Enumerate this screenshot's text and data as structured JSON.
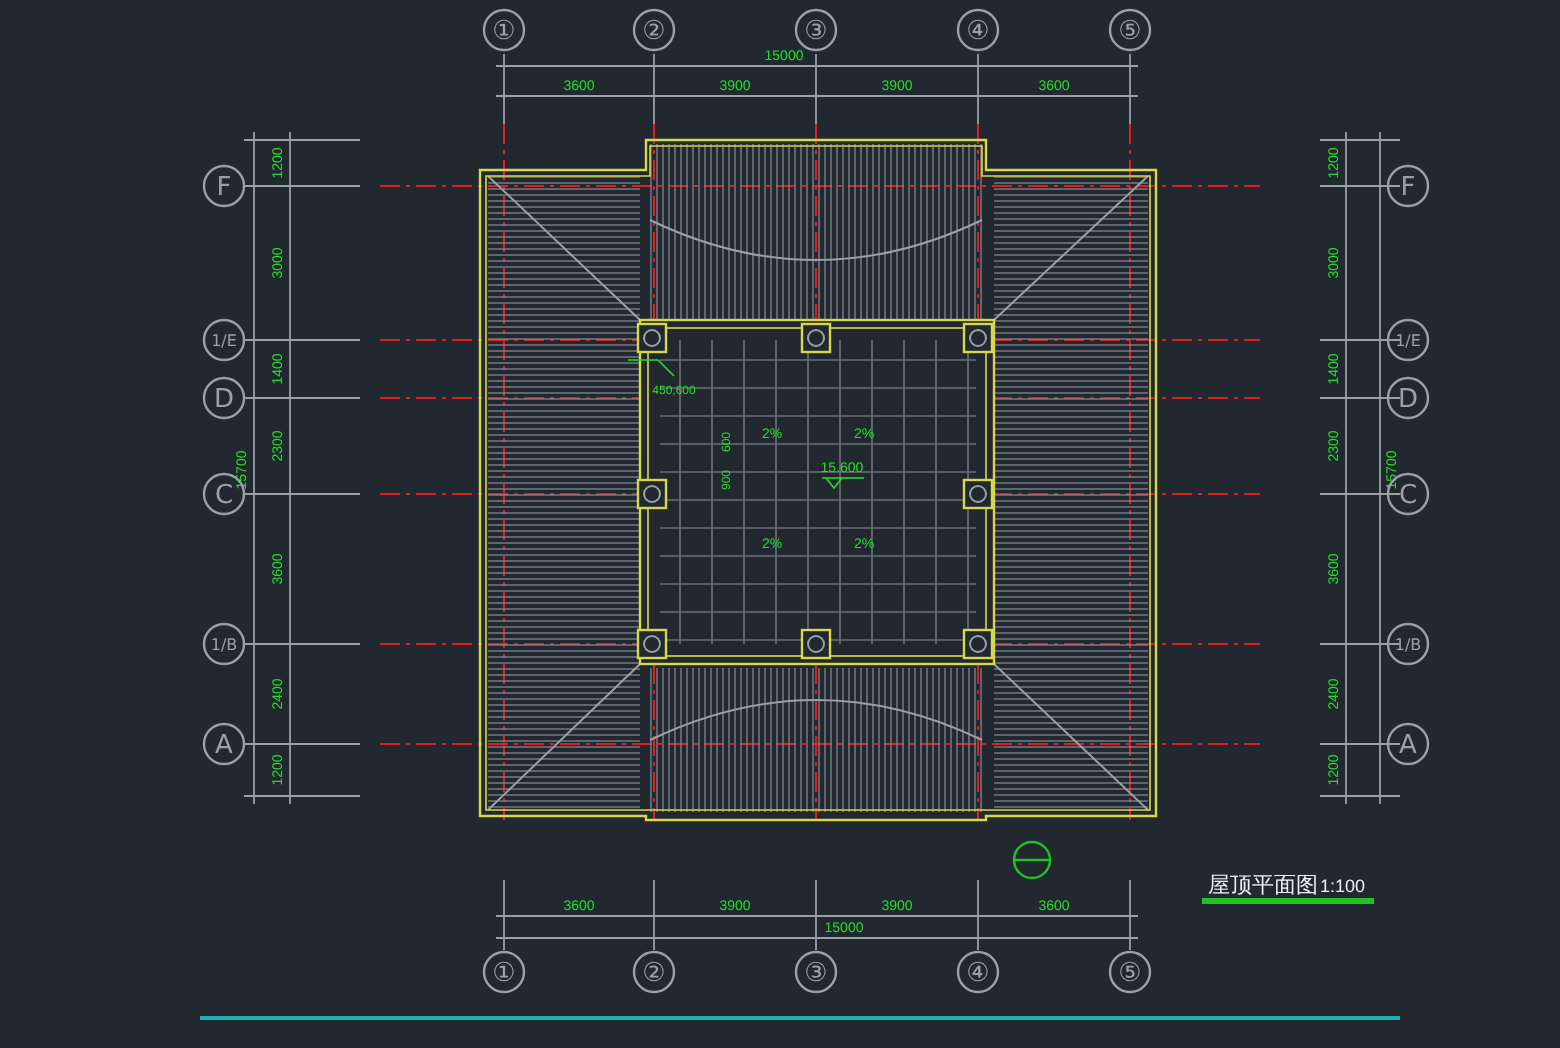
{
  "column_axes_top": [
    {
      "label": "①"
    },
    {
      "label": "②"
    },
    {
      "label": "③"
    },
    {
      "label": "④"
    },
    {
      "label": "⑤"
    }
  ],
  "row_axes_left": [
    {
      "label": "F"
    },
    {
      "label": "1/E"
    },
    {
      "label": "D"
    },
    {
      "label": "C"
    },
    {
      "label": "1/B"
    },
    {
      "label": "A"
    }
  ],
  "row_axes_right": [
    {
      "label": "F"
    },
    {
      "label": "1/E"
    },
    {
      "label": "D"
    },
    {
      "label": "C"
    },
    {
      "label": "1/B"
    },
    {
      "label": "A"
    }
  ],
  "column_axes_bottom": [
    {
      "label": "①"
    },
    {
      "label": "②"
    },
    {
      "label": "③"
    },
    {
      "label": "④"
    },
    {
      "label": "⑤"
    }
  ],
  "top_dimensions": {
    "total": "15000",
    "segments": [
      "3600",
      "3900",
      "3900",
      "3600"
    ]
  },
  "bottom_dimensions": {
    "total": "15000",
    "segments": [
      "3600",
      "3900",
      "3900",
      "3600"
    ]
  },
  "left_dimensions": {
    "total": "15700",
    "segments": [
      "1200",
      "3000",
      "1400",
      "2300",
      "3600",
      "2400",
      "1200"
    ]
  },
  "right_dimensions": {
    "total": "15700",
    "segments": [
      "1200",
      "3000",
      "1400",
      "2300",
      "3600",
      "2400",
      "1200"
    ]
  },
  "annotations": {
    "size_label": "450,600",
    "dimension_labels": [
      "600",
      "900"
    ],
    "elevation": "15.600",
    "slope_labels": [
      "2%",
      "2%",
      "2%",
      "2%"
    ]
  },
  "title": {
    "text": "屋顶平面图",
    "scale": "1:100"
  }
}
